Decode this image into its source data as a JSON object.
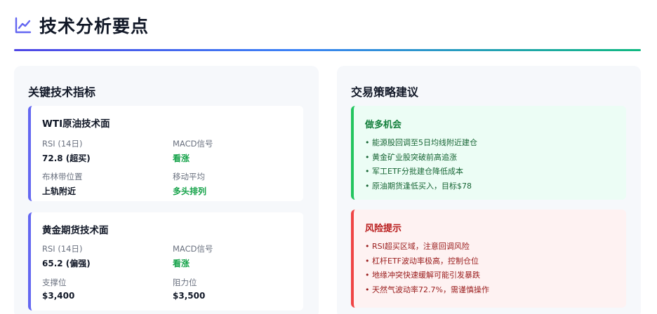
{
  "page": {
    "title": "技术分析要点",
    "title_icon": "line-chart-icon",
    "accent_color": "#6366f1"
  },
  "indicators": {
    "heading": "关键技术指标",
    "cards": [
      {
        "title": "WTI原油技术面",
        "metrics": [
          {
            "label": "RSI (14日)",
            "value": "72.8 (超买)",
            "color": "#111827"
          },
          {
            "label": "MACD信号",
            "value": "看涨",
            "color": "#16a34a"
          },
          {
            "label": "布林带位置",
            "value": "上轨附近",
            "color": "#111827"
          },
          {
            "label": "移动平均",
            "value": "多头排列",
            "color": "#16a34a"
          }
        ]
      },
      {
        "title": "黄金期货技术面",
        "metrics": [
          {
            "label": "RSI (14日)",
            "value": "65.2 (偏强)",
            "color": "#111827"
          },
          {
            "label": "MACD信号",
            "value": "看涨",
            "color": "#16a34a"
          },
          {
            "label": "支撑位",
            "value": "$3,400",
            "color": "#111827"
          },
          {
            "label": "阻力位",
            "value": "$3,500",
            "color": "#111827"
          }
        ]
      }
    ]
  },
  "strategy": {
    "heading": "交易策略建议",
    "opportunities": {
      "title": "做多机会",
      "color": "#16a34a",
      "items": [
        "能源股回调至5日均线附近建仓",
        "黄金矿业股突破前高追涨",
        "军工ETF分批建仓降低成本",
        "原油期货逢低买入，目标$78"
      ]
    },
    "risks": {
      "title": "风险提示",
      "color": "#dc2626",
      "items": [
        "RSI超买区域，注意回调风险",
        "杠杆ETF波动率极高，控制仓位",
        "地缘冲突快速缓解可能引发暴跌",
        "天然气波动率72.7%，需谨慎操作"
      ]
    }
  }
}
